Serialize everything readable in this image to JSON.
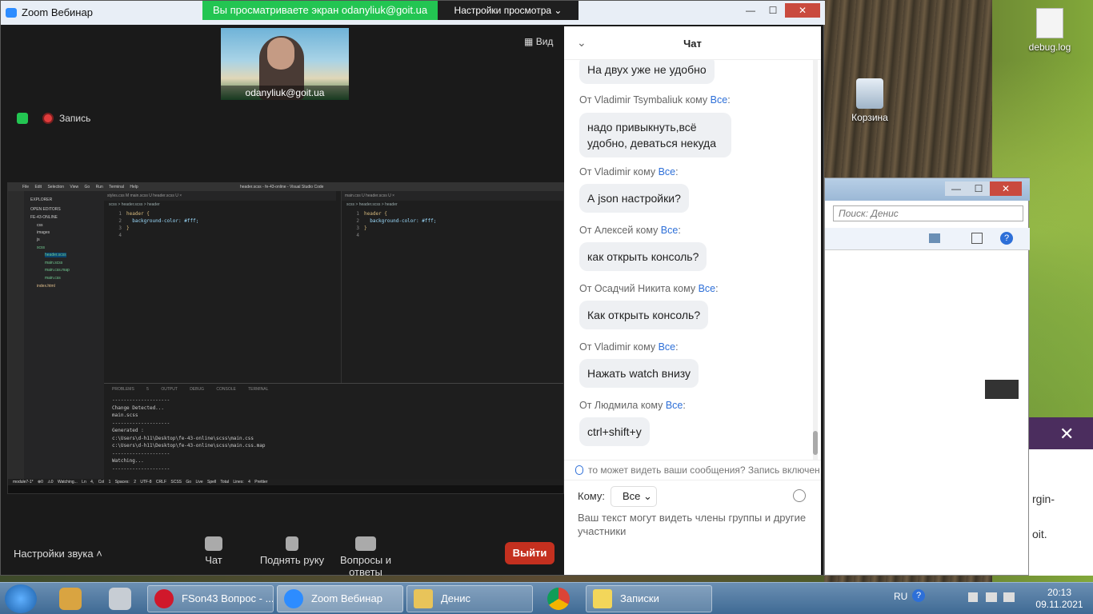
{
  "zoom": {
    "title": "Zoom Вебинар",
    "share_banner": "Вы просматриваете экран odanyliuk@goit.ua",
    "view_settings": "Настройки просмотра",
    "view_btn": "Вид",
    "camera_label": "odanyliuk@goit.ua",
    "recording_label": "Запись",
    "audio_settings": "Настройки звука",
    "bottom": {
      "chat": "Чат",
      "raise_hand": "Поднять руку",
      "qa": "Вопросы и ответы",
      "leave": "Выйти"
    }
  },
  "chat": {
    "title": "Чат",
    "first_bubble": "На двух уже не удобно",
    "messages": [
      {
        "from": "От Vladimir Tsymbaliuk кому ",
        "to": "Все",
        "suffix": ":",
        "text": "надо привыкнуть,всё удобно, деваться некуда"
      },
      {
        "from": "От Vladimir кому ",
        "to": "Все",
        "suffix": ":",
        "text": "А json настройки?"
      },
      {
        "from": "От Алексей кому ",
        "to": "Все",
        "suffix": ":",
        "text": "как открыть консоль?"
      },
      {
        "from": "От Осадчий Никита кому ",
        "to": "Все",
        "suffix": ":",
        "text": "Как открыть консоль?"
      },
      {
        "from": "От Vladimir кому ",
        "to": "Все",
        "suffix": ":",
        "text": "Нажать watch внизу"
      },
      {
        "from": "От Людмила кому ",
        "to": "Все",
        "suffix": ":",
        "text": "ctrl+shift+y"
      }
    ],
    "privacy_note": "то может видеть ваши сообщения? Запись включен",
    "to_label": "Кому:",
    "to_value": "Все",
    "input_placeholder": "Ваш текст могут видеть члены группы и другие участники"
  },
  "vscode": {
    "title": "header.scss - fe-43-online - Visual Studio Code",
    "menu": "File Edit Selection View Go Run Terminal Help",
    "sidebar": [
      "EXPLORER",
      "OPEN EDITORS",
      "FE-43-ONLINE",
      "css",
      "images",
      "js",
      "scss",
      "header.scss",
      "main.scss",
      "main.css.map",
      "main.css",
      "index.html"
    ],
    "left_tabs": "styles.css M   main.scss U   header.scss U ×",
    "right_tabs": "main.css U   header.scss U ×",
    "crumb": "scss > header.scss > header",
    "code": [
      "header {",
      "  background-color: #fff;",
      "}",
      ""
    ],
    "panel_tabs": "PROBLEMS 5 OUTPUT DEBUG CONSOLE TERMINAL",
    "output": "--------------------\nChange Detected...\nmain.scss\n--------------------\nGenerated :\nc:\\Users\\d-h11\\Desktop\\fe-43-online\\scss\\main.css\nc:\\Users\\d-h11\\Desktop\\fe-43-online\\scss\\main.css.map\n--------------------\nWatching...\n--------------------",
    "status": "module7-1*   ⊗0 ⚠0        Watching...   Ln 4, Col 1   Spaces: 2   UTF-8   CRLF   SCSS   Go Live   Spell   Total Lines: 4   Prettier"
  },
  "explorer": {
    "search_placeholder": "Поиск: Денис"
  },
  "notes": {
    "line1": "rgin-",
    "line2": "oit."
  },
  "desktop": {
    "debug_log": "debug.log",
    "recycle_bin": "Корзина"
  },
  "taskbar": {
    "tasks": [
      "FSon43 Вопрос - ...",
      "Zoom Вебинар",
      "Денис",
      "Записки"
    ],
    "lang": "RU",
    "time": "20:13",
    "date": "09.11.2021"
  }
}
